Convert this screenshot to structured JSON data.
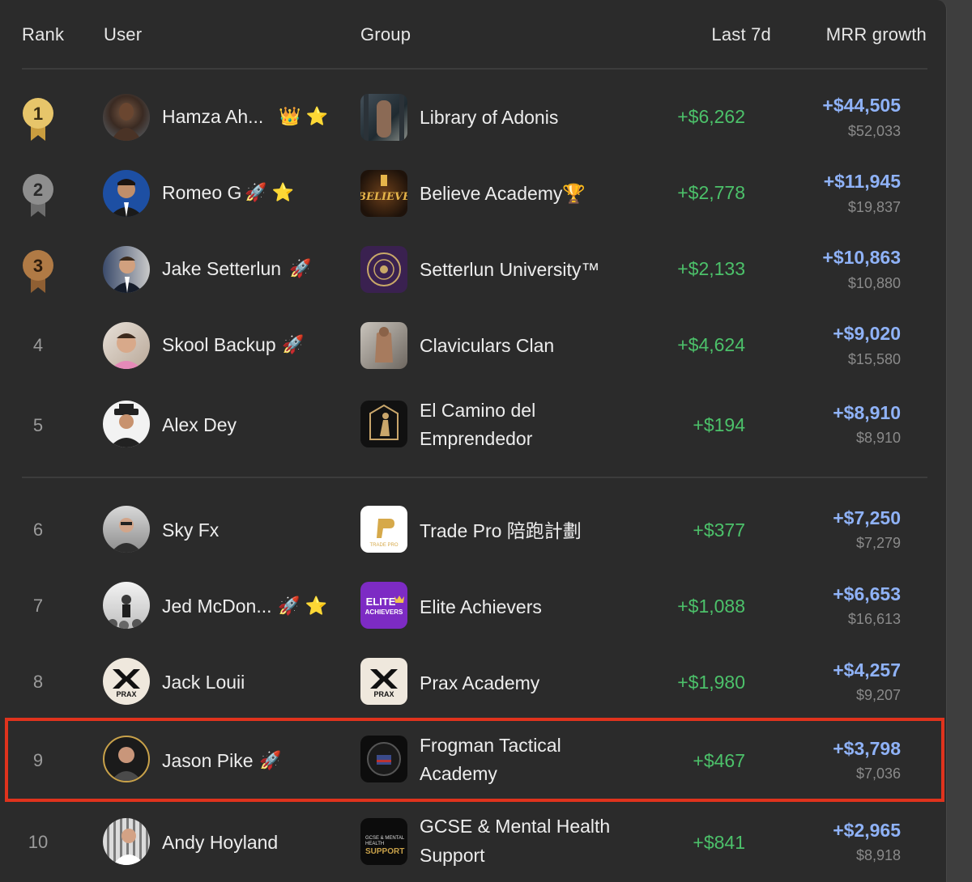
{
  "headers": {
    "rank": "Rank",
    "user": "User",
    "group": "Group",
    "last7d": "Last 7d",
    "mrr": "MRR growth"
  },
  "colors": {
    "gain": "#4cc16a",
    "mrr": "#8fb2f7",
    "gold": "#e7c56a",
    "silver": "#8e8e8e",
    "bronze": "#b07a45",
    "highlight": "#e0331d"
  },
  "rows": [
    {
      "rank": "1",
      "user": "Hamza Ah...",
      "badges": "👑 ⭐",
      "group": "Library of Adonis",
      "last7d": "+$6,262",
      "mrr": "+$44,505",
      "total": "$52,033"
    },
    {
      "rank": "2",
      "user": "Romeo G",
      "badges": "🚀 ⭐",
      "group": "Believe Academy🏆",
      "last7d": "+$2,778",
      "mrr": "+$11,945",
      "total": "$19,837"
    },
    {
      "rank": "3",
      "user": "Jake Setterlun",
      "badges": "🚀",
      "group": "Setterlun University™",
      "last7d": "+$2,133",
      "mrr": "+$10,863",
      "total": "$10,880"
    },
    {
      "rank": "4",
      "user": "Skool Backup",
      "badges": "🚀",
      "group": "Claviculars Clan",
      "last7d": "+$4,624",
      "mrr": "+$9,020",
      "total": "$15,580"
    },
    {
      "rank": "5",
      "user": "Alex Dey",
      "badges": "",
      "group_line1": "El Camino del",
      "group_line2": "Emprendedor",
      "last7d": "+$194",
      "mrr": "+$8,910",
      "total": "$8,910"
    },
    {
      "rank": "6",
      "user": "Sky Fx",
      "badges": "",
      "group": "Trade Pro 陪跑計劃",
      "last7d": "+$377",
      "mrr": "+$7,250",
      "total": "$7,279"
    },
    {
      "rank": "7",
      "user": "Jed McDon...",
      "badges": "🚀 ⭐",
      "group": "Elite Achievers",
      "last7d": "+$1,088",
      "mrr": "+$6,653",
      "total": "$16,613"
    },
    {
      "rank": "8",
      "user": "Jack Louii",
      "badges": "",
      "group": "Prax Academy",
      "last7d": "+$1,980",
      "mrr": "+$4,257",
      "total": "$9,207"
    },
    {
      "rank": "9",
      "user": "Jason Pike",
      "badges": "🚀",
      "group_line1": "Frogman Tactical",
      "group_line2": "Academy",
      "last7d": "+$467",
      "mrr": "+$3,798",
      "total": "$7,036"
    },
    {
      "rank": "10",
      "user": "Andy Hoyland",
      "badges": "",
      "group_line1": "GCSE & Mental Health",
      "group_line2": "Support",
      "last7d": "+$841",
      "mrr": "+$2,965",
      "total": "$8,918"
    }
  ],
  "logo_text": {
    "believe": "BELIEVE",
    "tradepro": "TRADE PRO",
    "elite_line1": "ELITE",
    "elite_line2": "ACHIEVERS",
    "prax": "PRAX",
    "gcse_line1": "GCSE & MENTAL",
    "gcse_line2": "HEALTH",
    "gcse_line3": "SUPPORT"
  }
}
